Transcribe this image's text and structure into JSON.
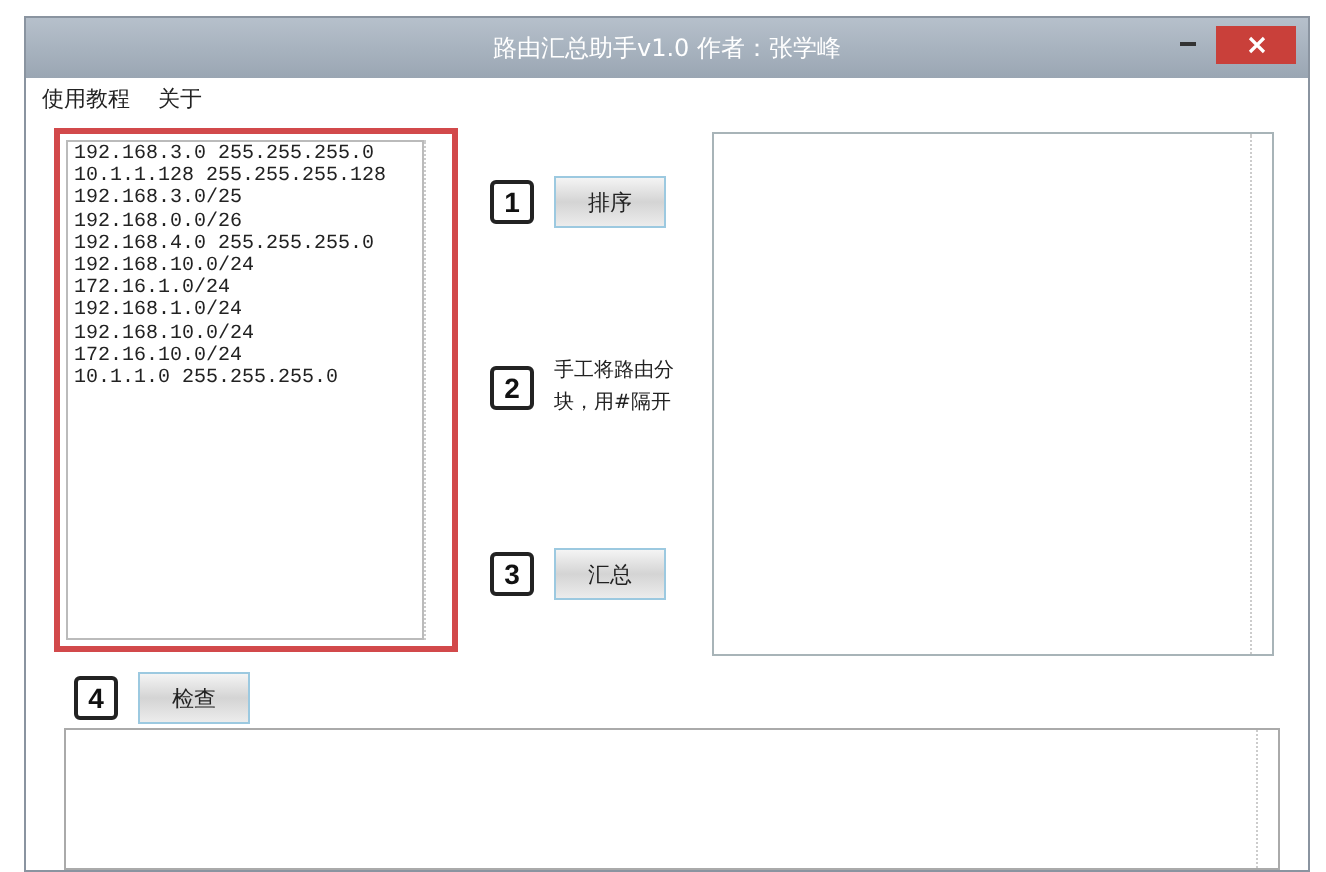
{
  "window": {
    "title": "路由汇总助手v1.0  作者：张学峰"
  },
  "menu": [
    {
      "label": "使用教程"
    },
    {
      "label": "关于"
    }
  ],
  "input_panel": {
    "highlighted": true,
    "lines": [
      "192.168.3.0 255.255.255.0",
      "10.1.1.128 255.255.255.128",
      "192.168.3.0/25",
      "192.168.0.0/26",
      "192.168.4.0 255.255.255.0",
      "192.168.10.0/24",
      "172.16.1.0/24",
      "192.168.1.0/24",
      "192.168.10.0/24",
      "172.16.10.0/24",
      "10.1.1.0 255.255.255.0"
    ]
  },
  "steps": [
    {
      "number": "1",
      "kind": "button",
      "label": "排序"
    },
    {
      "number": "2",
      "kind": "note",
      "label": "手工将路由分块，用#隔开"
    },
    {
      "number": "3",
      "kind": "button",
      "label": "汇总"
    }
  ],
  "check_step": {
    "number": "4",
    "label": "检查"
  }
}
